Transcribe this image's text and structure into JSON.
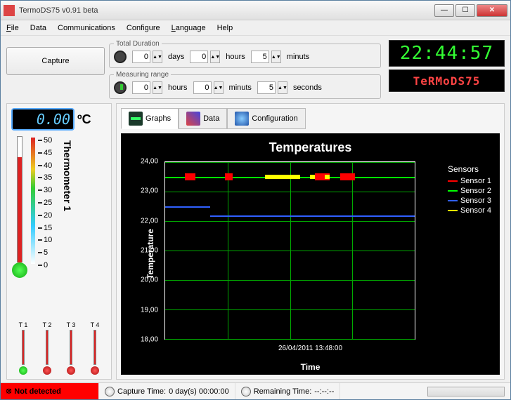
{
  "window": {
    "title": "TermoDS75 v0.91 beta"
  },
  "menu": {
    "file": "File",
    "data": "Data",
    "comm": "Communications",
    "config": "Configure",
    "lang": "Language",
    "help": "Help"
  },
  "capture": {
    "label": "Capture"
  },
  "total_duration": {
    "legend": "Total Duration",
    "days": {
      "value": "0",
      "label": "days"
    },
    "hours": {
      "value": "0",
      "label": "hours"
    },
    "min": {
      "value": "5",
      "label": "minuts"
    }
  },
  "measuring_range": {
    "legend": "Measuring range",
    "hours": {
      "value": "0",
      "label": "hours"
    },
    "min": {
      "value": "0",
      "label": "minuts"
    },
    "sec": {
      "value": "5",
      "label": "seconds"
    }
  },
  "clock": "22:44:57",
  "logo": "TeRMoDS75",
  "lcd": {
    "value": "0.00",
    "unit": "ºC"
  },
  "thermo": {
    "label": "Thermometer 1",
    "ticks": [
      "50",
      "45",
      "40",
      "35",
      "30",
      "25",
      "20",
      "15",
      "10",
      "5",
      "0"
    ]
  },
  "mini": {
    "t1": "T 1",
    "t2": "T 2",
    "t3": "T 3",
    "t4": "T 4"
  },
  "tabs": {
    "graphs": "Graphs",
    "data": "Data",
    "config": "Configuration"
  },
  "chart_data": {
    "type": "line",
    "title": "Temperatures",
    "xlabel": "Time",
    "ylabel": "Temperature",
    "ylim": [
      18,
      24
    ],
    "yticks": [
      "24,00",
      "23,00",
      "22,00",
      "21,00",
      "20,00",
      "19,00",
      "18,00"
    ],
    "xtick": "26/04/2011 13:48:00",
    "legend_title": "Sensors",
    "series": [
      {
        "name": "Sensor 1",
        "color": "#ff0000",
        "approx_level": 23.4
      },
      {
        "name": "Sensor 2",
        "color": "#00ff00",
        "approx_level": 23.5
      },
      {
        "name": "Sensor 3",
        "color": "#3060ff",
        "approx_level": 22.3
      },
      {
        "name": "Sensor 4",
        "color": "#ffff00",
        "approx_level": 23.4
      }
    ]
  },
  "status": {
    "not_detected": "Not detected",
    "capture_time_label": "Capture Time:",
    "capture_time_value": "0 day(s) 00:00:00",
    "remaining_label": "Remaining Time:",
    "remaining_value": "--:--:--"
  }
}
